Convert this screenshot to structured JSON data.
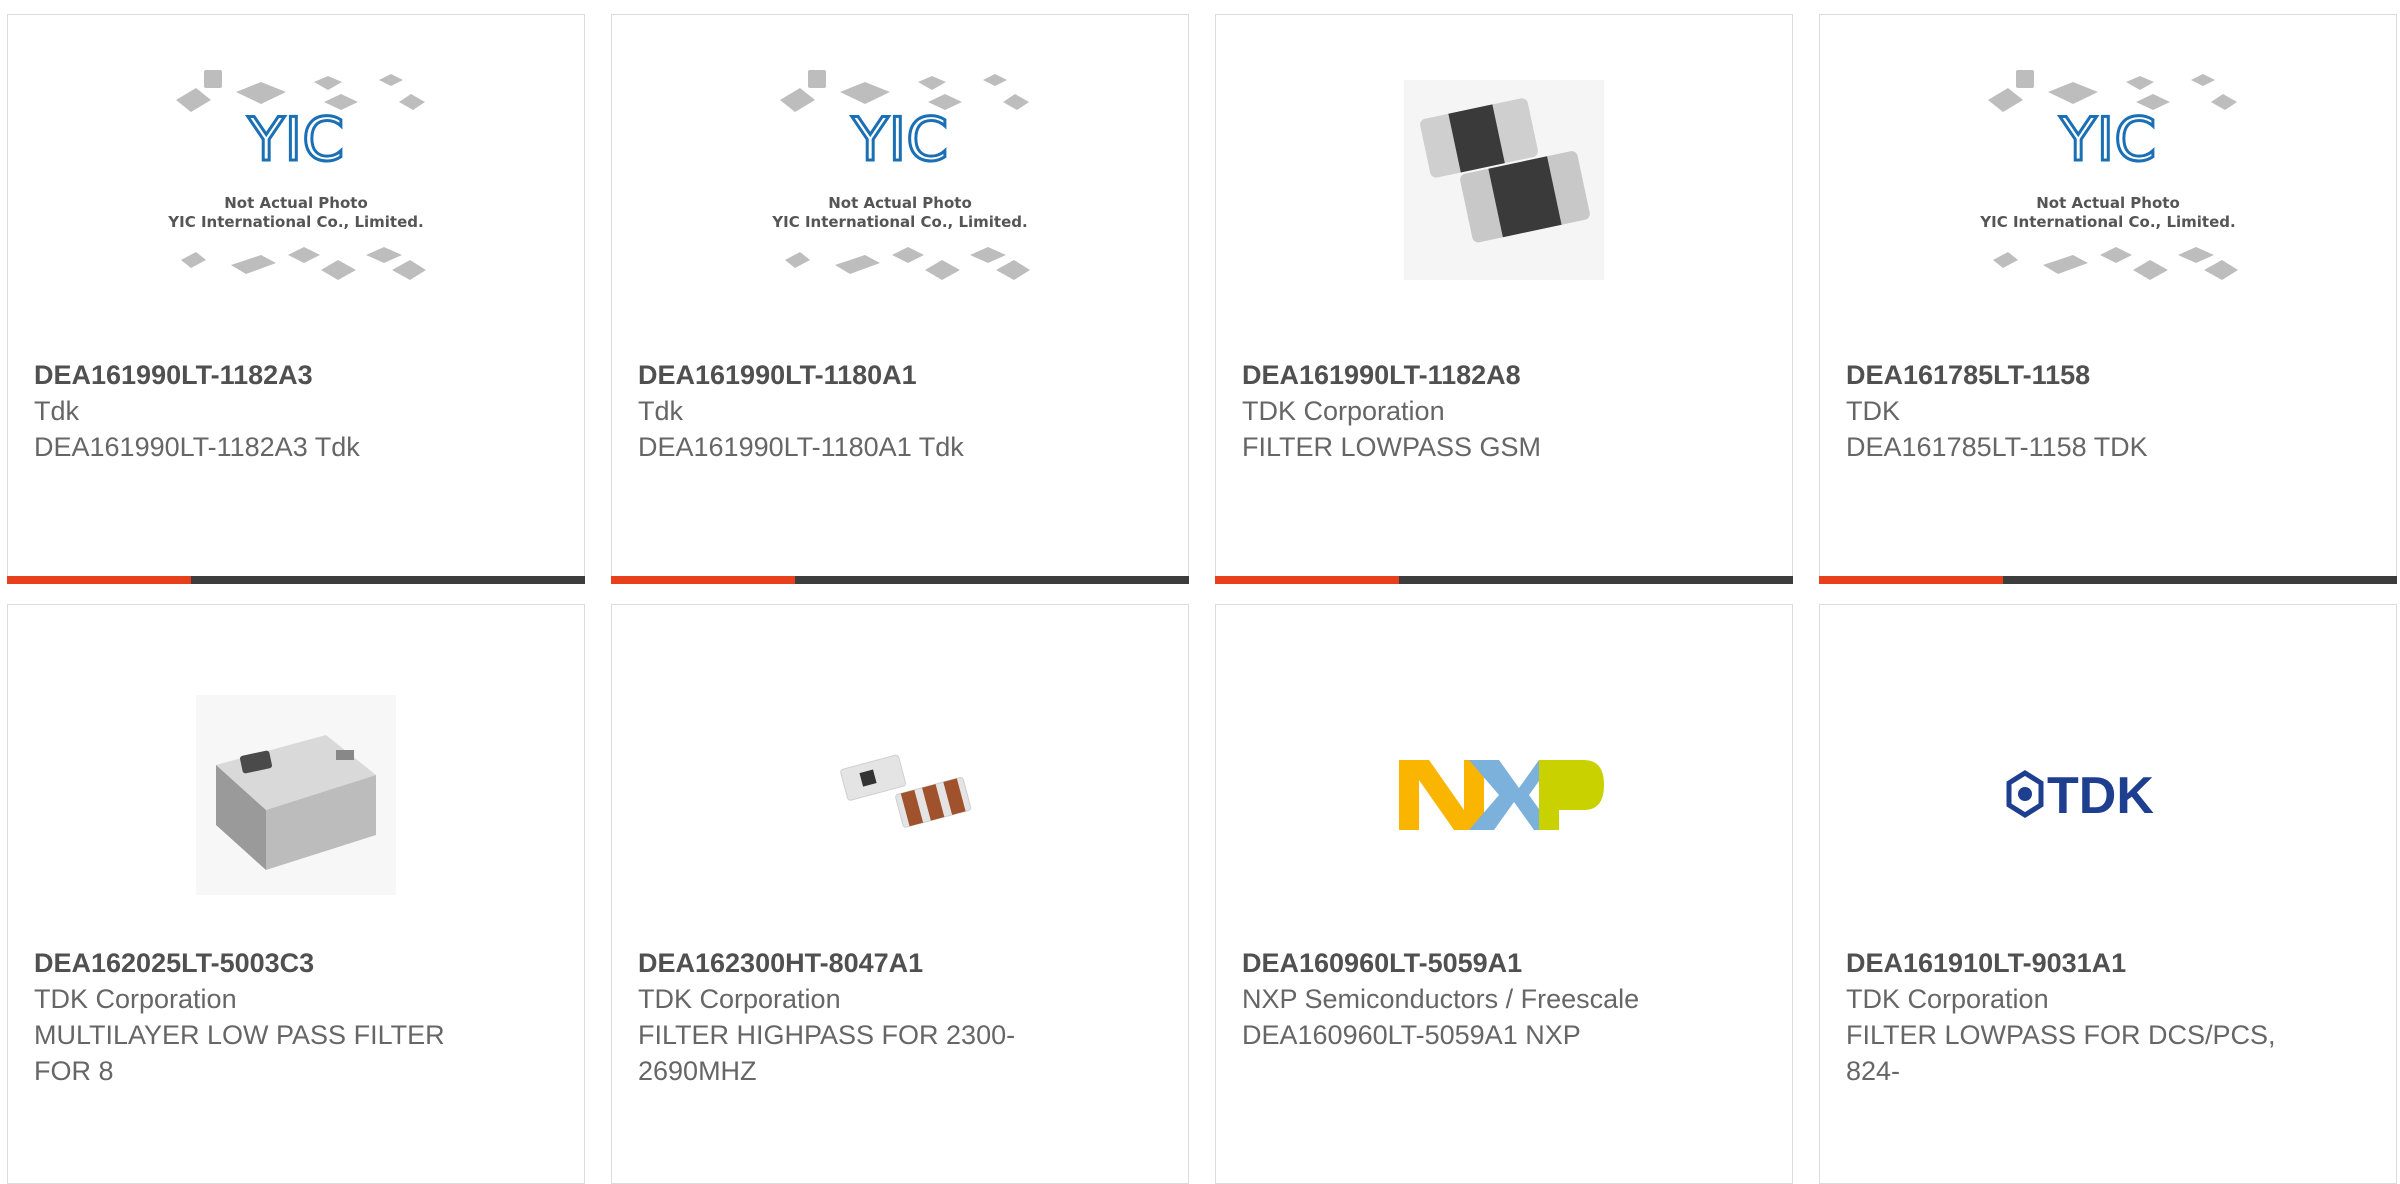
{
  "placeholder": {
    "line1": "Not Actual Photo",
    "line2": "YIC International Co., Limited.",
    "logo": "YIC"
  },
  "colors": {
    "accent": "#e8401c",
    "bar": "#3d3d3d",
    "border": "#dcdcdc",
    "text": "#666666"
  },
  "products": [
    {
      "part_number": "DEA161990LT-1182A3",
      "manufacturer": "Tdk",
      "description": "DEA161990LT-1182A3 Tdk",
      "image": "not-actual-photo-placeholder"
    },
    {
      "part_number": "DEA161990LT-1180A1",
      "manufacturer": "Tdk",
      "description": "DEA161990LT-1180A1 Tdk",
      "image": "not-actual-photo-placeholder"
    },
    {
      "part_number": "DEA161990LT-1182A8",
      "manufacturer": "TDK Corporation",
      "description": "FILTER LOWPASS GSM",
      "image": "smd-filter-component-photo"
    },
    {
      "part_number": "DEA161785LT-1158",
      "manufacturer": "TDK",
      "description": "DEA161785LT-1158 TDK",
      "image": "not-actual-photo-placeholder"
    },
    {
      "part_number": "DEA162025LT-5003C3",
      "manufacturer": "TDK Corporation",
      "description": "MULTILAYER LOW PASS FILTER FOR 8",
      "image": "multilayer-chip-photo"
    },
    {
      "part_number": "DEA162300HT-8047A1",
      "manufacturer": "TDK Corporation",
      "description": "FILTER HIGHPASS FOR 2300-2690MHZ",
      "image": "small-chip-pair-photo"
    },
    {
      "part_number": "DEA160960LT-5059A1",
      "manufacturer": "NXP Semiconductors / Freescale",
      "description": "DEA160960LT-5059A1 NXP",
      "image": "nxp-logo",
      "logo_text": "NXP"
    },
    {
      "part_number": "DEA161910LT-9031A1",
      "manufacturer": "TDK Corporation",
      "description": "FILTER LOWPASS FOR DCS/PCS, 824-",
      "image": "tdk-logo",
      "logo_text": "TDK"
    }
  ]
}
